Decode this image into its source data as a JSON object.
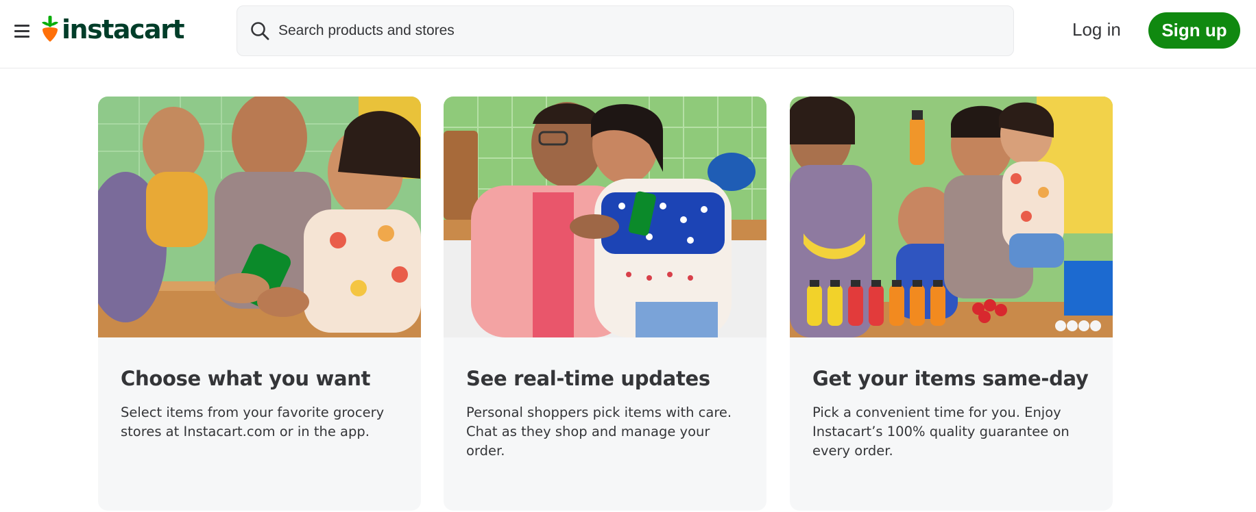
{
  "header": {
    "brand": "instacart",
    "search_placeholder": "Search products and stores",
    "login_label": "Log in",
    "signup_label": "Sign up",
    "accent_color": "#108910",
    "brand_color": "#003d29",
    "carrot_color": "#ff7009"
  },
  "icons": {
    "menu": "hamburger-menu-icon",
    "search": "search-icon",
    "logo": "carrot-logo-icon"
  },
  "cards": [
    {
      "title": "Choose what you want",
      "description": "Select items from your favorite grocery stores at Instacart.com or in the app."
    },
    {
      "title": "See real-time updates",
      "description": "Personal shoppers pick items with care. Chat as they shop and manage your order."
    },
    {
      "title": "Get your items same-day",
      "description": "Pick a convenient time for you. Enjoy Instacart’s 100% quality guarantee on every order."
    }
  ]
}
